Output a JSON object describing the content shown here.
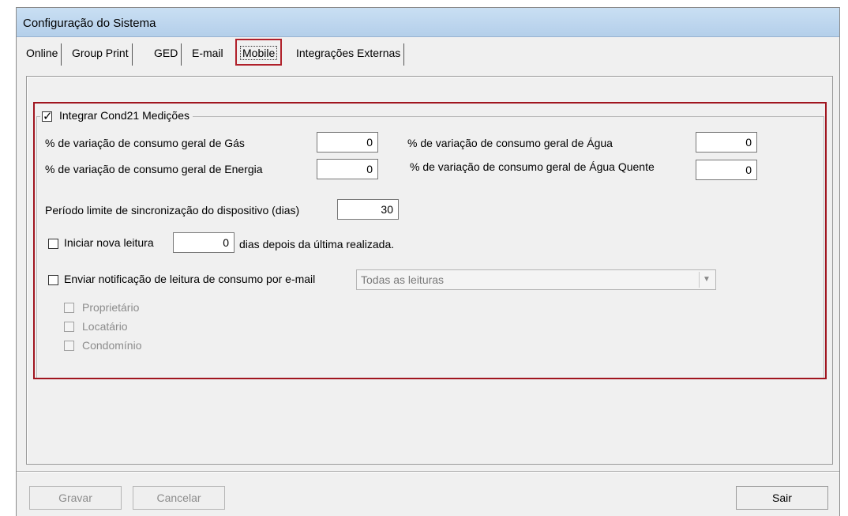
{
  "window": {
    "title": "Configuração do Sistema"
  },
  "tabs": [
    {
      "label": "Online"
    },
    {
      "label": "Group Print"
    },
    {
      "label": "GED"
    },
    {
      "label": "E-mail"
    },
    {
      "label": "Mobile"
    },
    {
      "label": "Integrações Externas"
    }
  ],
  "active_tab": "Mobile",
  "group": {
    "checkbox_label": "Integrar Cond21 Medições",
    "checked": true
  },
  "fields": {
    "gas_label": "% de variação de consumo geral de Gás",
    "gas_value": "0",
    "energia_label": "% de variação de consumo geral de Energia",
    "energia_value": "0",
    "agua_label": "% de variação de consumo geral de Água",
    "agua_value": "0",
    "agua_quente_label": "% de variação de consumo geral de Água Quente",
    "agua_quente_value": "0",
    "periodo_label": "Período limite de sincronização do dispositivo (dias)",
    "periodo_value": "30",
    "nova_leitura_label": "Iniciar nova leitura",
    "nova_leitura_value": "0",
    "nova_leitura_suffix": "dias depois da última realizada.",
    "notificacao_label": "Enviar notificação de leitura de consumo por e-mail",
    "notificacao_select": "Todas as leituras",
    "proprietario_label": "Proprietário",
    "locatario_label": "Locatário",
    "condominio_label": "Condomínio"
  },
  "buttons": {
    "gravar": "Gravar",
    "cancelar": "Cancelar",
    "sair": "Sair"
  },
  "colors": {
    "highlight": "#a0151f",
    "title_bg": "#c9dff3"
  }
}
